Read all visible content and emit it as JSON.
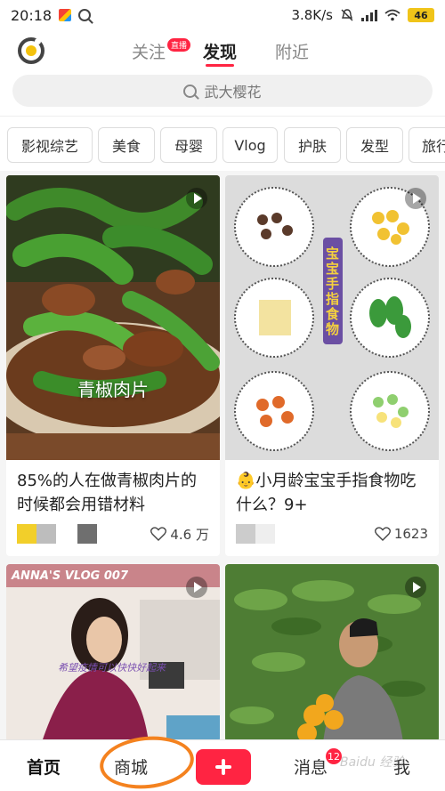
{
  "status_bar": {
    "time": "20:18",
    "network_speed": "3.8K/s",
    "battery": "46",
    "icons": [
      "app-icon",
      "search-icon",
      "mute-icon",
      "signal-icon",
      "wifi-icon",
      "battery-icon"
    ]
  },
  "top_nav": {
    "tabs": [
      {
        "label": "关注",
        "badge": "直播"
      },
      {
        "label": "发现",
        "active": true
      },
      {
        "label": "附近"
      }
    ]
  },
  "search": {
    "placeholder": "武大樱花"
  },
  "categories": [
    "影视综艺",
    "美食",
    "母婴",
    "Vlog",
    "护肤",
    "发型",
    "旅行"
  ],
  "feed": [
    {
      "title": "85%的人在做青椒肉片的时候都会用错材料",
      "image_caption": "青椒肉片",
      "likes": "4.6 万",
      "has_video": true,
      "swatch_colors": [
        "#f2cf2a",
        "#bdbdbd",
        "#6f6f6f"
      ]
    },
    {
      "title": "👶小月龄宝宝手指食物吃什么？9+",
      "image_caption": "宝宝手指食物",
      "likes": "1623",
      "has_video": true,
      "swatch_colors": [
        "#cccccc",
        "#eeeeee"
      ]
    },
    {
      "title": "",
      "image_caption": "ANNA'S VLOG 007",
      "image_subcaption": "希望疫情可以快快好起来",
      "has_video": true
    },
    {
      "title": "",
      "has_video": true
    }
  ],
  "bottom_nav": {
    "items": [
      "首页",
      "商城",
      "消息",
      "我"
    ],
    "message_badge": "12"
  },
  "annotation": {
    "color": "#f4821f",
    "target": "商城"
  },
  "watermark": "Baidu 经验",
  "colors": {
    "accent": "#ff2442",
    "highlight": "#f4c20d"
  }
}
